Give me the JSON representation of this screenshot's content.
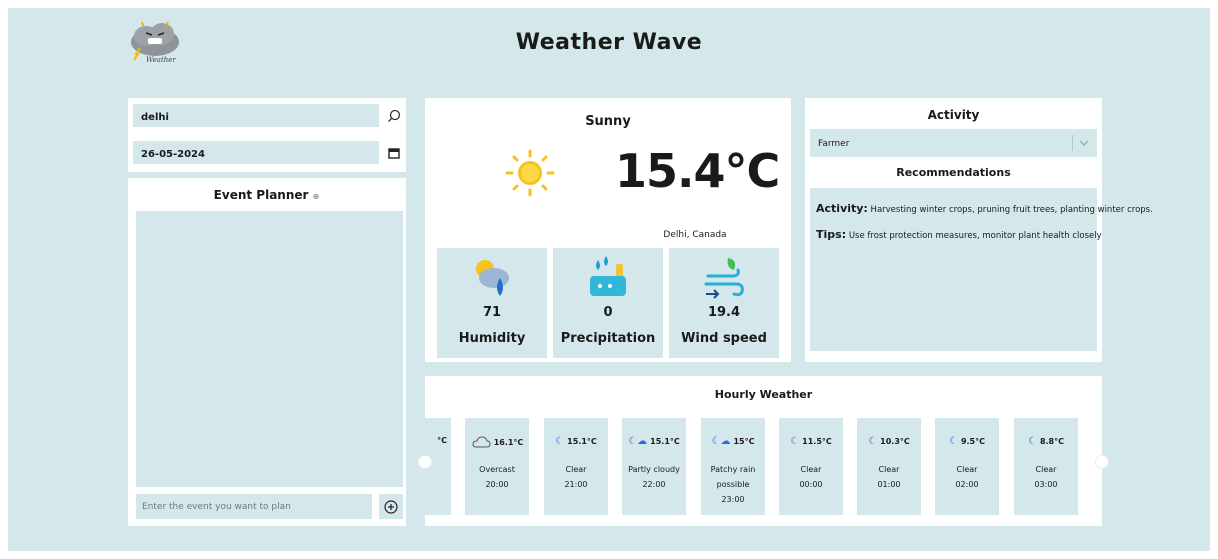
{
  "app": {
    "title": "Weather Wave",
    "logo_text": "Weather"
  },
  "search": {
    "value": "delhi"
  },
  "date": {
    "value": "26-05-2024"
  },
  "planner": {
    "title": "Event Planner",
    "placeholder": "Enter the event you want to plan"
  },
  "current": {
    "condition": "Sunny",
    "temperature": "15.4°C",
    "location": "Delhi, Canada",
    "stats": [
      {
        "value": "71",
        "label": "Humidity"
      },
      {
        "value": "0",
        "label": "Precipitation"
      },
      {
        "value": "19.4",
        "label": "Wind speed"
      }
    ]
  },
  "activity": {
    "title": "Activity",
    "selected": "Farmer",
    "rec_title": "Recommendations",
    "activity_label": "Activity:",
    "activity_text": "Harvesting winter crops, pruning fruit trees, planting winter crops.",
    "tips_label": "Tips:",
    "tips_text": "Use frost protection measures, monitor plant health closely"
  },
  "hourly": {
    "title": "Hourly Weather",
    "partial_temp": "°C",
    "items": [
      {
        "temp": "16.1°C",
        "condition": "Overcast",
        "time": "20:00",
        "icon": "cloud-icon"
      },
      {
        "temp": "15.1°C",
        "condition": "Clear",
        "time": "21:00",
        "icon": "moon-icon"
      },
      {
        "temp": "15.1°C",
        "condition": "Partly cloudy",
        "time": "22:00",
        "icon": "moon-cloud-icon"
      },
      {
        "temp": "15°C",
        "condition": "Patchy rain possible",
        "time": "23:00",
        "icon": "moon-rain-icon"
      },
      {
        "temp": "11.5°C",
        "condition": "Clear",
        "time": "00:00",
        "icon": "moon-icon"
      },
      {
        "temp": "10.3°C",
        "condition": "Clear",
        "time": "01:00",
        "icon": "moon-icon"
      },
      {
        "temp": "9.5°C",
        "condition": "Clear",
        "time": "02:00",
        "icon": "moon-icon"
      },
      {
        "temp": "8.8°C",
        "condition": "Clear",
        "time": "03:00",
        "icon": "moon-icon"
      }
    ]
  },
  "colors": {
    "panel_bg": "#d4e7ea",
    "card_bg": "#ffffff",
    "sun": "#f7c31a",
    "moon": "#2b6fd6"
  }
}
